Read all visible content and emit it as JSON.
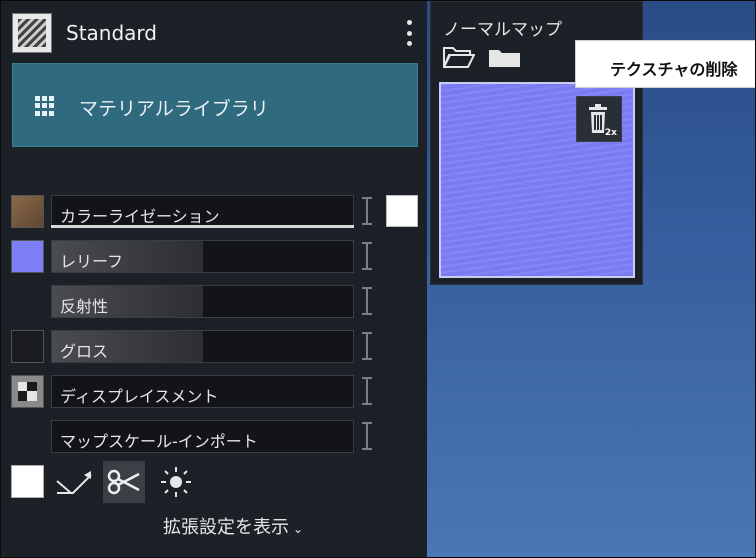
{
  "header": {
    "preset_name": "Standard"
  },
  "library": {
    "label": "マテリアルライブラリ"
  },
  "channels": [
    {
      "label": "カラーライゼーション",
      "swatch_color": "#7b5e42"
    },
    {
      "label": "レリーフ",
      "swatch_color": "#7f7ef9"
    },
    {
      "label": "反射性"
    },
    {
      "label": "グロス",
      "swatch_color": "#1a1c20"
    },
    {
      "label": "ディスプレイスメント"
    },
    {
      "label": "マップスケール-インポート"
    }
  ],
  "footer": {
    "expand_label": "拡張設定を表示"
  },
  "normal_map": {
    "title": "ノーマルマップ",
    "texture_color": "#7f7ef9",
    "trash_badge": "2x"
  },
  "tooltip": {
    "text": "テクスチャの削除"
  },
  "colors": {
    "panel_bg": "#1c2027",
    "library_bg": "#2f6a7e",
    "viewport_top": "#2a4b86",
    "viewport_bottom": "#4a78b4"
  }
}
